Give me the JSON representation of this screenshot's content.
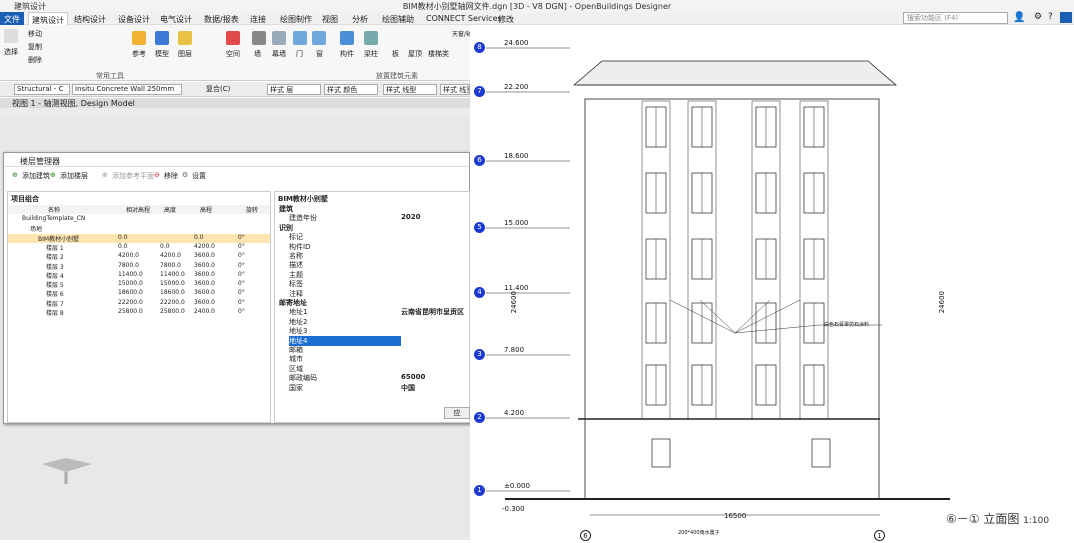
{
  "app": {
    "mode_label": "建筑设计",
    "title": "BIM教材小别墅轴网文件.dgn [3D - V8 DGN] - OpenBuildings Designer"
  },
  "menu": [
    "文件",
    "建筑设计",
    "结构设计",
    "设备设计",
    "电气设计",
    "数据/报表",
    "连接",
    "绘图制作",
    "视图",
    "分析",
    "绘图辅助",
    "CONNECT Services",
    "修改"
  ],
  "search": {
    "placeholder": "搜索功能区 (F4)"
  },
  "ribbon": {
    "select": "选择",
    "move": "移动",
    "copy": "复制",
    "delete": "删除",
    "ref": "参考",
    "model": "模型",
    "layer": "图层",
    "space": "空间",
    "wall": "墙",
    "curtain": "幕墙",
    "door": "门",
    "window": "窗",
    "member": "构件",
    "column": "梁柱",
    "slab": "板",
    "roof": "屋顶",
    "stair": "楼梯类",
    "skylight": "天窗/轴网",
    "group_common": "常用工具",
    "group_place": "放置建筑元素"
  },
  "propbar": {
    "family": "Structural - C",
    "part": "Insitu Concrete Wall 250mm",
    "composite": "复合(C)",
    "style_layer": "样式 层",
    "style_color": "样式 颜色",
    "style_line": "样式 线型",
    "style_width": "样式 线宽"
  },
  "view": {
    "title": "视图 1 - 轴测视图, Design Model"
  },
  "dialog": {
    "title": "楼层管理器",
    "add_building": "添加建筑",
    "add_floor": "添加楼层",
    "add_ref": "添加参考平面",
    "delete": "移除",
    "settings": "设置",
    "combo_header": "项目组合",
    "columns": [
      "名称",
      "相对高程",
      "高度",
      "高程",
      "旋转"
    ],
    "tree": [
      {
        "name": "BuildingTemplate_CN",
        "elev": "",
        "height": "",
        "abs": "",
        "rot": "",
        "level": 0
      },
      {
        "name": "场地",
        "elev": "",
        "height": "",
        "abs": "",
        "rot": "",
        "level": 1
      },
      {
        "name": "BIM教材小别墅",
        "elev": "0.0",
        "height": "",
        "abs": "0.0",
        "rot": "0°",
        "level": 2
      },
      {
        "name": "楼层 1",
        "elev": "0.0",
        "height": "0.0",
        "abs": "4200.0",
        "rot": "0°",
        "level": 3
      },
      {
        "name": "楼层 2",
        "elev": "4200.0",
        "height": "4200.0",
        "abs": "3600.0",
        "rot": "0°",
        "level": 3
      },
      {
        "name": "楼层 3",
        "elev": "7800.0",
        "height": "7800.0",
        "abs": "3600.0",
        "rot": "0°",
        "level": 3
      },
      {
        "name": "楼层 4",
        "elev": "11400.0",
        "height": "11400.0",
        "abs": "3600.0",
        "rot": "0°",
        "level": 3
      },
      {
        "name": "楼层 5",
        "elev": "15000.0",
        "height": "15000.0",
        "abs": "3600.0",
        "rot": "0°",
        "level": 3
      },
      {
        "name": "楼层 6",
        "elev": "18600.0",
        "height": "18600.0",
        "abs": "3600.0",
        "rot": "0°",
        "level": 3
      },
      {
        "name": "楼层 7",
        "elev": "22200.0",
        "height": "22200.0",
        "abs": "3600.0",
        "rot": "0°",
        "level": 3
      },
      {
        "name": "楼层 8",
        "elev": "25800.0",
        "height": "25800.0",
        "abs": "2400.0",
        "rot": "0°",
        "level": 3
      }
    ],
    "props_title": "BIM教材小别墅",
    "props": [
      {
        "k": "建筑",
        "v": "",
        "section": true
      },
      {
        "k": "建造年份",
        "v": "2020"
      },
      {
        "k": "识别",
        "v": "",
        "section": true
      },
      {
        "k": "标记",
        "v": ""
      },
      {
        "k": "构件ID",
        "v": ""
      },
      {
        "k": "名称",
        "v": ""
      },
      {
        "k": "描述",
        "v": ""
      },
      {
        "k": "主题",
        "v": ""
      },
      {
        "k": "标签",
        "v": ""
      },
      {
        "k": "注释",
        "v": ""
      },
      {
        "k": "邮寄地址",
        "v": "",
        "section": true
      },
      {
        "k": "地址1",
        "v": "云南省昆明市呈贡区"
      },
      {
        "k": "地址2",
        "v": ""
      },
      {
        "k": "地址3",
        "v": ""
      },
      {
        "k": "地址4",
        "v": "",
        "hl": true
      },
      {
        "k": "邮箱",
        "v": ""
      },
      {
        "k": "城市",
        "v": ""
      },
      {
        "k": "区域",
        "v": ""
      },
      {
        "k": "邮政编码",
        "v": "65000"
      },
      {
        "k": "国家",
        "v": "中国"
      }
    ],
    "ok": "应"
  },
  "drawing": {
    "levels": [
      {
        "n": "8",
        "v": "24.600"
      },
      {
        "n": "7",
        "v": "22.200"
      },
      {
        "n": "6",
        "v": "18.600"
      },
      {
        "n": "5",
        "v": "15.000"
      },
      {
        "n": "4",
        "v": "11.400"
      },
      {
        "n": "3",
        "v": "7.800"
      },
      {
        "n": "2",
        "v": "4.200"
      },
      {
        "n": "1",
        "v": "±0.000"
      }
    ],
    "ground": "-0.300",
    "total_h": "24600",
    "width": "16500",
    "note": "白色石膏罩仿石涂料",
    "left_axis": "6",
    "right_axis": "1",
    "bottom_note": "200*400雨水篦子",
    "caption": "⑥－① 立面图",
    "scale": "1:100"
  },
  "colors": {
    "accent": "#1a5fb4",
    "bubble": "#1c3ad1",
    "selection": "#ffe6b0"
  }
}
